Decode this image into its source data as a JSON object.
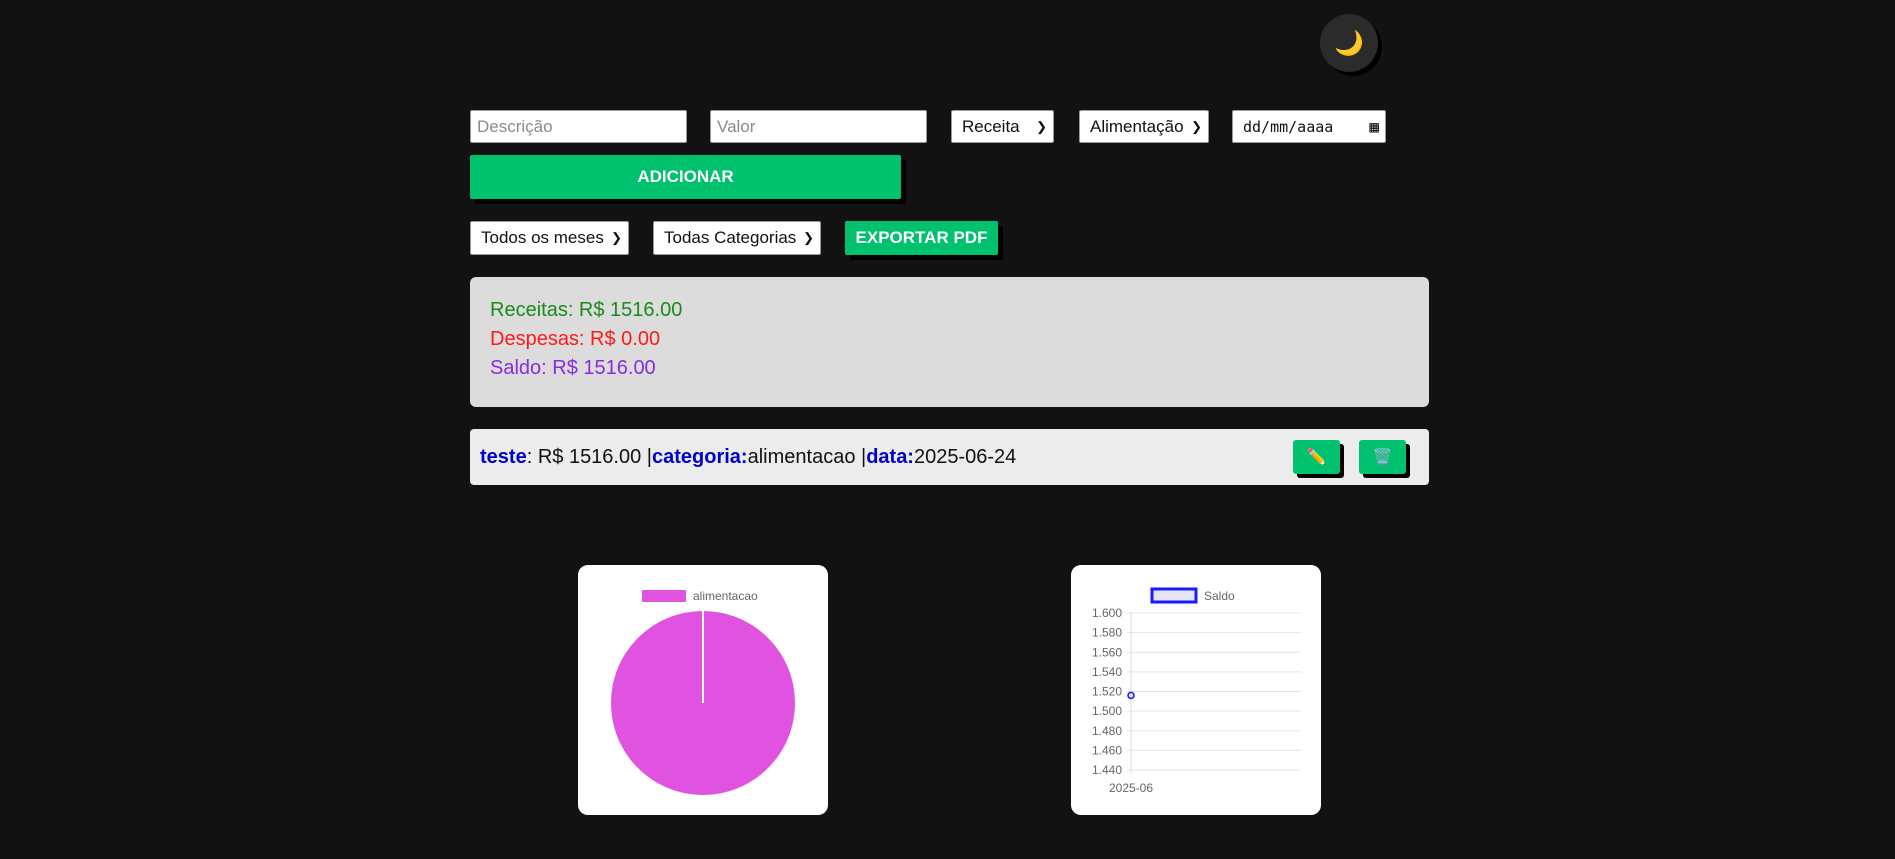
{
  "theme_toggle": {
    "icon": "🌙"
  },
  "form": {
    "description_placeholder": "Descrição",
    "value_placeholder": "Valor",
    "type_selected": "Receita",
    "category_selected": "Alimentação",
    "date_placeholder": "dd/mm/aaaa",
    "add_label": "ADICIONAR"
  },
  "filters": {
    "month_selected": "Todos os meses",
    "category_selected": "Todas Categorias",
    "export_label": "EXPORTAR PDF"
  },
  "summary": {
    "income": "Receitas: R$ 1516.00",
    "expenses": "Despesas: R$ 0.00",
    "balance": "Saldo: R$ 1516.00",
    "income_color": "#1a8a1a",
    "expenses_color": "#ff1a1a",
    "balance_color": "#8a2be2"
  },
  "transactions": [
    {
      "description": "teste",
      "value_text": ": R$ 1516.00 | ",
      "category_label": "categoria:",
      "category_text": " alimentacao | ",
      "date_label": "data:",
      "date_text": " 2025-06-24",
      "edit_icon": "✏️",
      "delete_icon": "🗑️"
    }
  ],
  "chart_data": [
    {
      "type": "pie",
      "legend": [
        "alimentacao"
      ],
      "values": [
        1516
      ],
      "colors": [
        "#e052e0"
      ]
    },
    {
      "type": "line",
      "legend": [
        "Saldo"
      ],
      "categories": [
        "2025-06"
      ],
      "series": [
        {
          "name": "Saldo",
          "values": [
            1516
          ]
        }
      ],
      "ylim": [
        1440,
        1600
      ],
      "yticks": [
        "1.600",
        "1.580",
        "1.560",
        "1.540",
        "1.520",
        "1.500",
        "1.480",
        "1.460",
        "1.440"
      ],
      "series_color": "#1a1aff",
      "grid": true
    }
  ]
}
